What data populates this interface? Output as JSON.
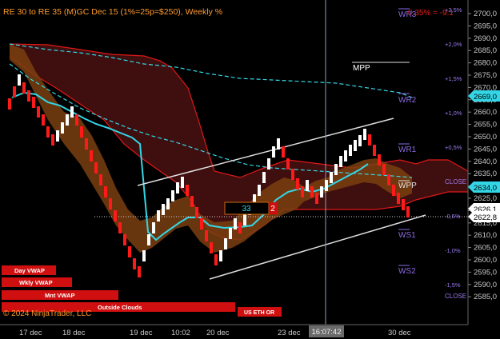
{
  "chart_title": "RE 30 to RE 35 (M)GC Dec 15 (1%=25p=$250), Weekly %",
  "top_right_label": "WR3",
  "top_right_change": "0.35% = -9.1",
  "copyright": "© 2024 NinjaTrader, LLC",
  "price_axis": {
    "ticks": [
      "2700,0",
      "2695,0",
      "2690,0",
      "2685,0",
      "2680,0",
      "2675,0",
      "2670,0",
      "2665,0",
      "2660,0",
      "2655,0",
      "2650,0",
      "2645,0",
      "2640,0",
      "2635,0",
      "2630,0",
      "2625,0",
      "2620,0",
      "2615,0",
      "2610,0",
      "2605,0",
      "2600,0",
      "2595,0",
      "2590,0",
      "2585,0"
    ],
    "markers": [
      {
        "label": "2669,0",
        "color": "#33d6e6",
        "text_color": "#000000"
      },
      {
        "label": "2634,0",
        "color": "#33d6e6",
        "text_color": "#000000"
      },
      {
        "label": "2626,1",
        "color": "#ffffff",
        "text_color": "#000000"
      },
      {
        "label": "2622,8",
        "color": "#ffffff",
        "text_color": "#000000"
      }
    ]
  },
  "percent_levels": [
    "+2,5%",
    "+2,0%",
    "+1,5%",
    "+1,0%",
    "+0,5%",
    "-0,5%",
    "-1,0%",
    "-1,5%"
  ],
  "pivot_labels": [
    "WR2",
    "WR1",
    "WPP",
    "WS1",
    "WS2",
    "MPP"
  ],
  "close_labels": [
    "CLOSE",
    "CLOSE"
  ],
  "time_axis": {
    "labels": [
      "17 dec",
      "18 dec",
      "19 dec",
      "10:02",
      "20 dec",
      "23 dec",
      "30 dec"
    ],
    "crosshair_time": "16:07:42"
  },
  "box_value": "33",
  "box_value_red": "2",
  "legend_buttons": [
    {
      "label": "Day VWAP"
    },
    {
      "label": "Wkly VWAP"
    },
    {
      "label": "Mnt VWAP"
    },
    {
      "label": "Outside Clouds"
    },
    {
      "label": "US ETH OR"
    }
  ],
  "colors": {
    "up_bar": "#ffffff",
    "down_bar": "#ff1a1a",
    "vwap": "#33d6e6",
    "band_fill": "#8a4a12",
    "cloud_fill": "#5a1414",
    "cloud_line": "#e01818",
    "pivot_label": "#8a6ae0",
    "percent_label": "#9a7aee"
  }
}
